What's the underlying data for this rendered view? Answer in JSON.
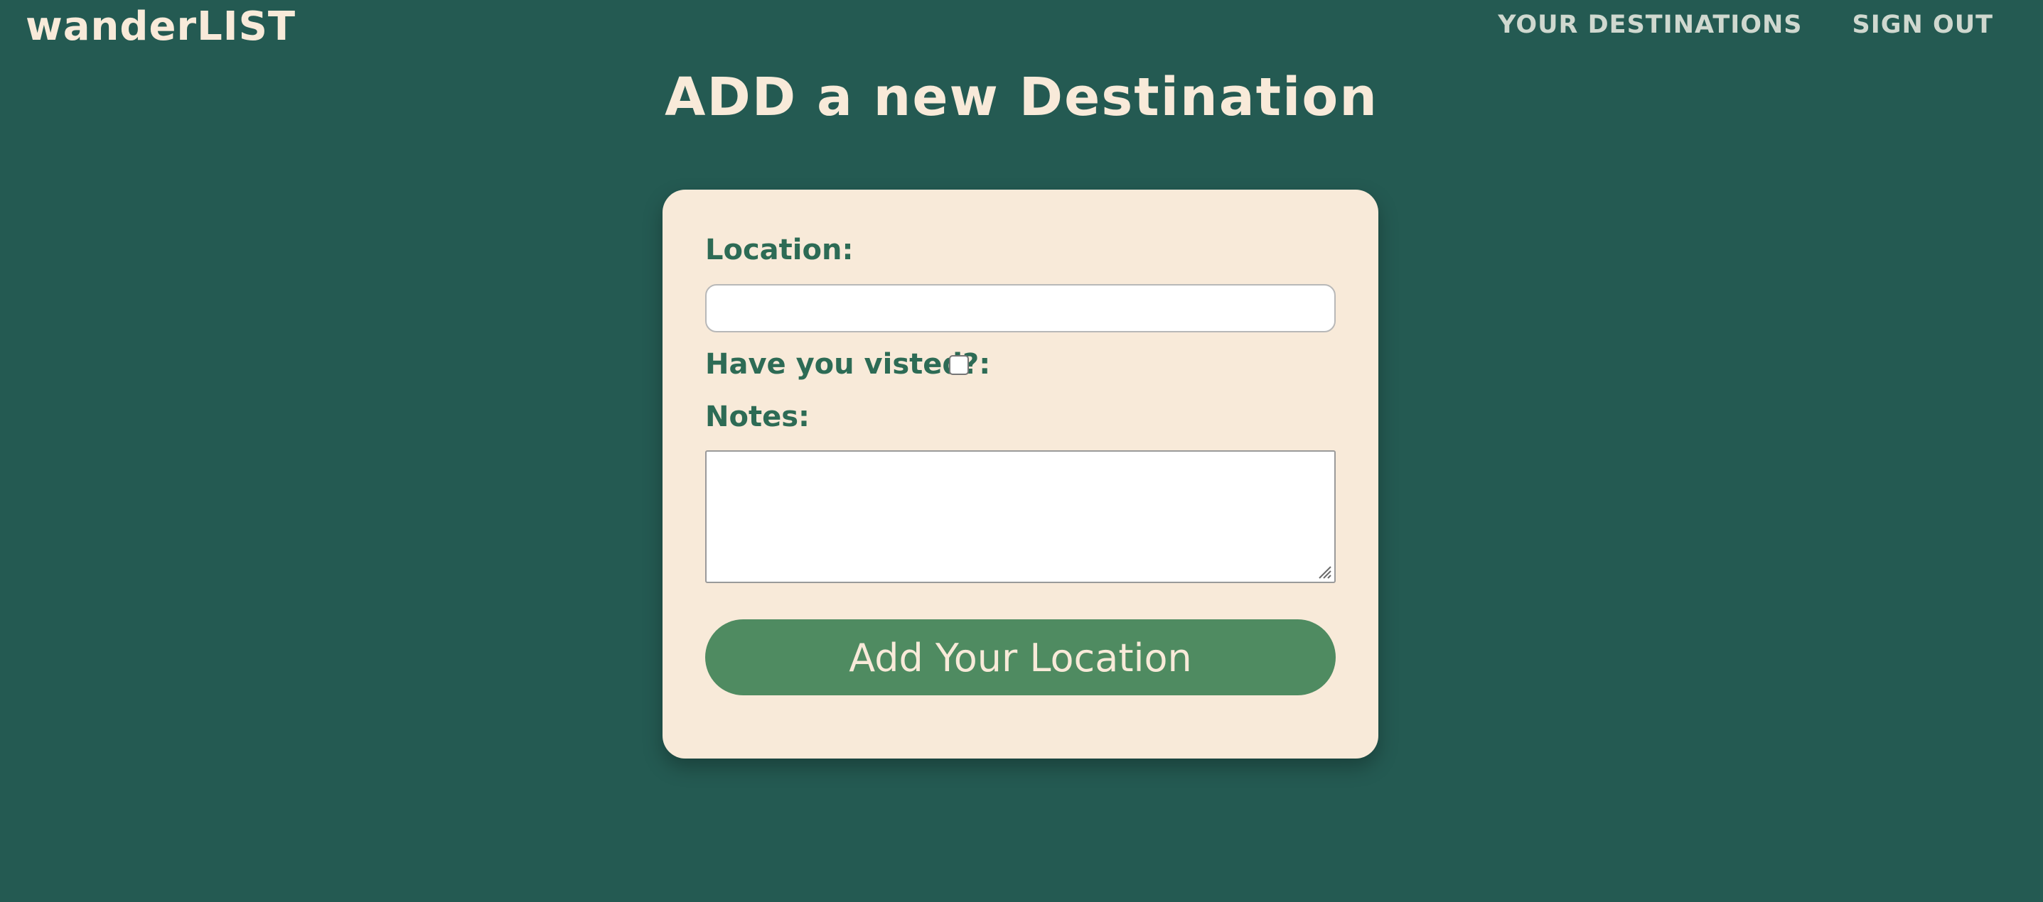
{
  "header": {
    "brand": "wanderLIST",
    "nav": {
      "destinations": "Your Destinations",
      "sign_out": "Sign Out"
    }
  },
  "main": {
    "title": "ADD a new Destination",
    "form": {
      "location_label": "Location:",
      "location_value": "",
      "visited_label": "Have you visted?:",
      "visited_checked": false,
      "notes_label": "Notes:",
      "notes_value": "",
      "submit_label": "Add Your Location"
    }
  },
  "colors": {
    "background": "#245a52",
    "card": "#f8ead9",
    "label_text": "#2d6b55",
    "button": "#4f8b61",
    "button_text": "#f8ead9"
  }
}
